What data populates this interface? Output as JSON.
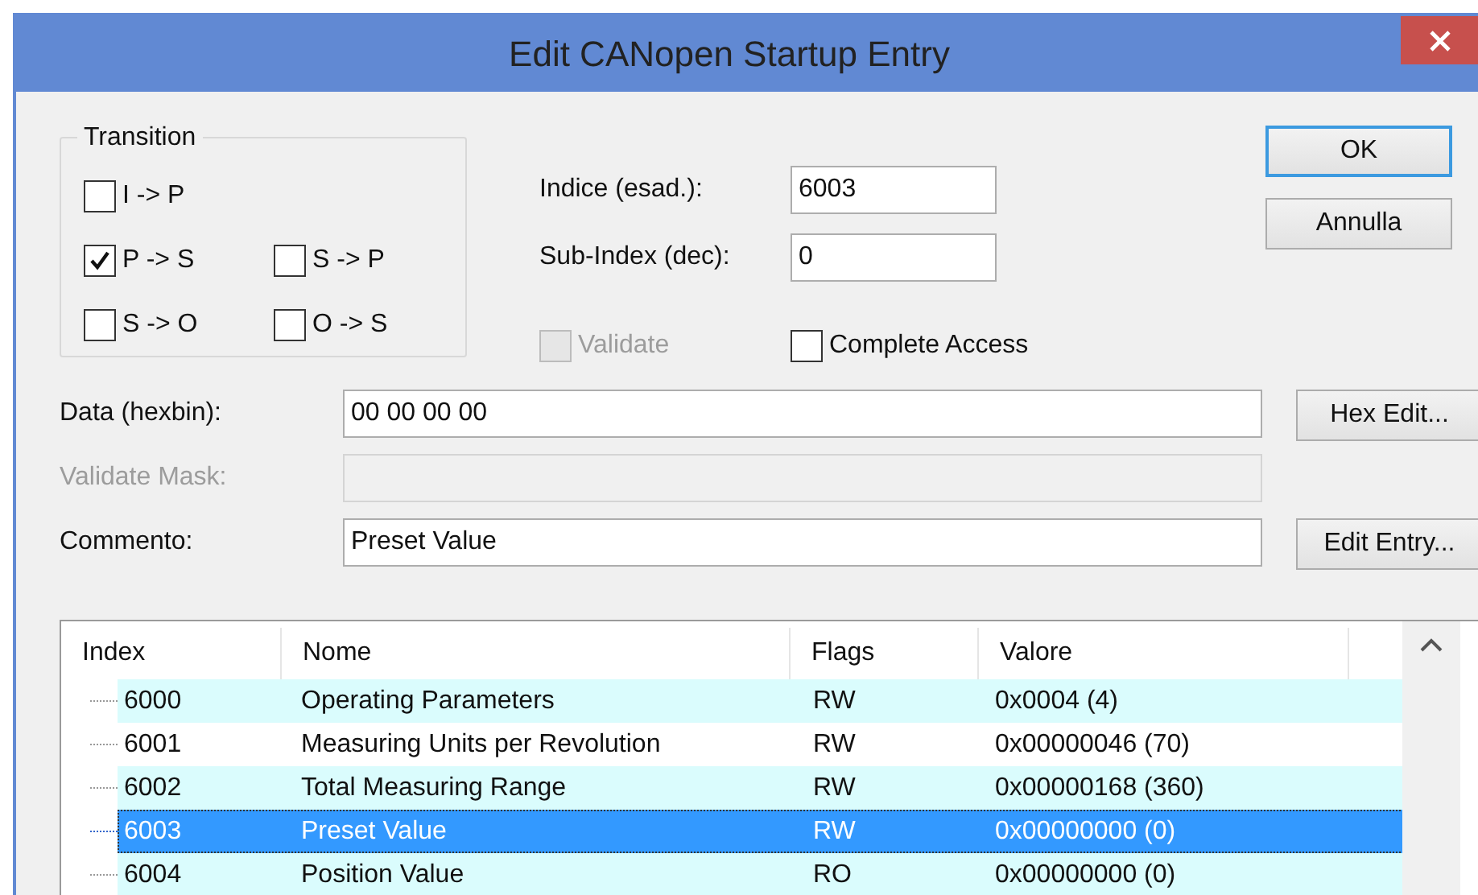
{
  "window": {
    "title": "Edit CANopen Startup Entry"
  },
  "transition": {
    "label": "Transition",
    "rows": [
      [
        {
          "label": "I -> P",
          "checked": false
        }
      ],
      [
        {
          "label": "P -> S",
          "checked": true
        },
        {
          "label": "S -> P",
          "checked": false
        }
      ],
      [
        {
          "label": "S -> O",
          "checked": false
        },
        {
          "label": "O -> S",
          "checked": false
        }
      ]
    ]
  },
  "index_field": {
    "label": "Indice (esad.):",
    "value": "6003"
  },
  "subindex_field": {
    "label": "Sub-Index (dec):",
    "value": "0"
  },
  "validate": {
    "label": "Validate",
    "checked": false,
    "disabled": true
  },
  "complete_access": {
    "label": "Complete Access",
    "checked": false,
    "disabled": false
  },
  "ok_button": {
    "label": "OK",
    "focused": true
  },
  "cancel_button": {
    "label": "Annulla",
    "focused": false
  },
  "data": {
    "label": "Data (hexbin):",
    "value": "00 00 00 00",
    "disabled": false,
    "button": "Hex Edit..."
  },
  "validate_mask": {
    "label": "Validate Mask:",
    "disabled": true
  },
  "comment": {
    "label": "Commento:",
    "value": "Preset Value",
    "disabled": false,
    "button": "Edit Entry..."
  },
  "table": {
    "columns": [
      "Index",
      "Nome",
      "Flags",
      "Valore"
    ],
    "rows": [
      {
        "index": "6000",
        "name": "Operating Parameters",
        "flags": "RW",
        "value": "0x0004 (4)",
        "selected": false
      },
      {
        "index": "6001",
        "name": "Measuring Units per Revolution",
        "flags": "RW",
        "value": "0x00000046 (70)",
        "selected": false
      },
      {
        "index": "6002",
        "name": "Total Measuring Range",
        "flags": "RW",
        "value": "0x00000168 (360)",
        "selected": false
      },
      {
        "index": "6003",
        "name": "Preset Value",
        "flags": "RW",
        "value": "0x00000000 (0)",
        "selected": true
      },
      {
        "index": "6004",
        "name": "Position Value",
        "flags": "RO",
        "value": "0x00000000 (0)",
        "selected": false
      }
    ]
  }
}
